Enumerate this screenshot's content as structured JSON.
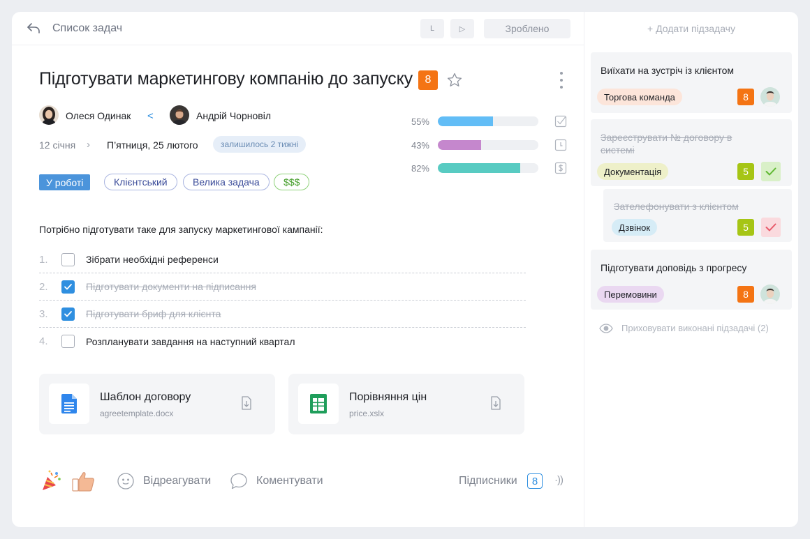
{
  "header": {
    "back_label": "Список задач",
    "btn_l": "L",
    "btn_play": "▷",
    "done_label": "Зроблено",
    "add_subtask": "+ Додати підзадачу"
  },
  "task": {
    "title": "Підготувати маркетингову компанію до запуску",
    "priority": "8",
    "author": "Олеся Одинак",
    "assignee": "Андрій Чорновіл",
    "date_start": "12 січня",
    "date_end": "П’ятниця, 25 лютого",
    "remaining": "залишилось 2 тижні",
    "status": "У роботі",
    "tags": [
      "Клієнтський",
      "Велика задача",
      "$$$"
    ],
    "description": "Потрібно підготувати таке для запуску маркетингової кампанії:"
  },
  "progress": [
    {
      "label": "55%",
      "value": 55,
      "color": "#62bdf6",
      "icon": "checkbox-icon"
    },
    {
      "label": "43%",
      "value": 43,
      "color": "#c587cd",
      "icon": "clock-icon"
    },
    {
      "label": "82%",
      "value": 82,
      "color": "#58cbc2",
      "icon": "dollar-icon"
    }
  ],
  "checklist": [
    {
      "num": "1.",
      "text": "Зібрати необхідні референси",
      "checked": false
    },
    {
      "num": "2.",
      "text": "Підготувати документи на підписання",
      "checked": true
    },
    {
      "num": "3.",
      "text": "Підготувати бриф для клієнта",
      "checked": true
    },
    {
      "num": "4.",
      "text": "Розпланувати завдання на наступний квартал",
      "checked": false
    }
  ],
  "files": [
    {
      "name": "Шаблон договору",
      "file": "agreetemplate.docx",
      "icon": "doc-icon"
    },
    {
      "name": "Порівняння цін",
      "file": "price.xslx",
      "icon": "sheet-icon"
    }
  ],
  "footer": {
    "react_label": "Відреагувати",
    "comment_label": "Коментувати",
    "subscribers_label": "Підписники",
    "subscribers_count": "8",
    "sound_glyph": "·))"
  },
  "subtasks": [
    {
      "title": "Виїхати на зустріч із клієнтом",
      "tag": "Торгова команда",
      "tag_color": "#fce5da",
      "priority": "8",
      "priority_color": "#f47414",
      "done": false,
      "struck": false
    },
    {
      "title": "Зареєструвати № договору в системі",
      "tag": "Документація",
      "tag_color": "#eef0c9",
      "priority": "5",
      "priority_color": "#a6c515",
      "done": true,
      "struck": true
    },
    {
      "title": "Зателефонувати з клієнтом",
      "tag": "Дзвінок",
      "tag_color": "#d6ecf6",
      "priority": "5",
      "priority_color": "#a6c515",
      "done": true,
      "struck": true
    },
    {
      "title": "Підготувати доповідь з прогресу",
      "tag": "Перемовини",
      "tag_color": "#ead8f1",
      "priority": "8",
      "priority_color": "#f47414",
      "done": false,
      "struck": false
    }
  ],
  "hide_done_label": "Приховувати виконані підзадачі (2)",
  "colors": {
    "accent": "#2f8fe0",
    "priority_high": "#f47414",
    "priority_mid": "#a6c515"
  }
}
